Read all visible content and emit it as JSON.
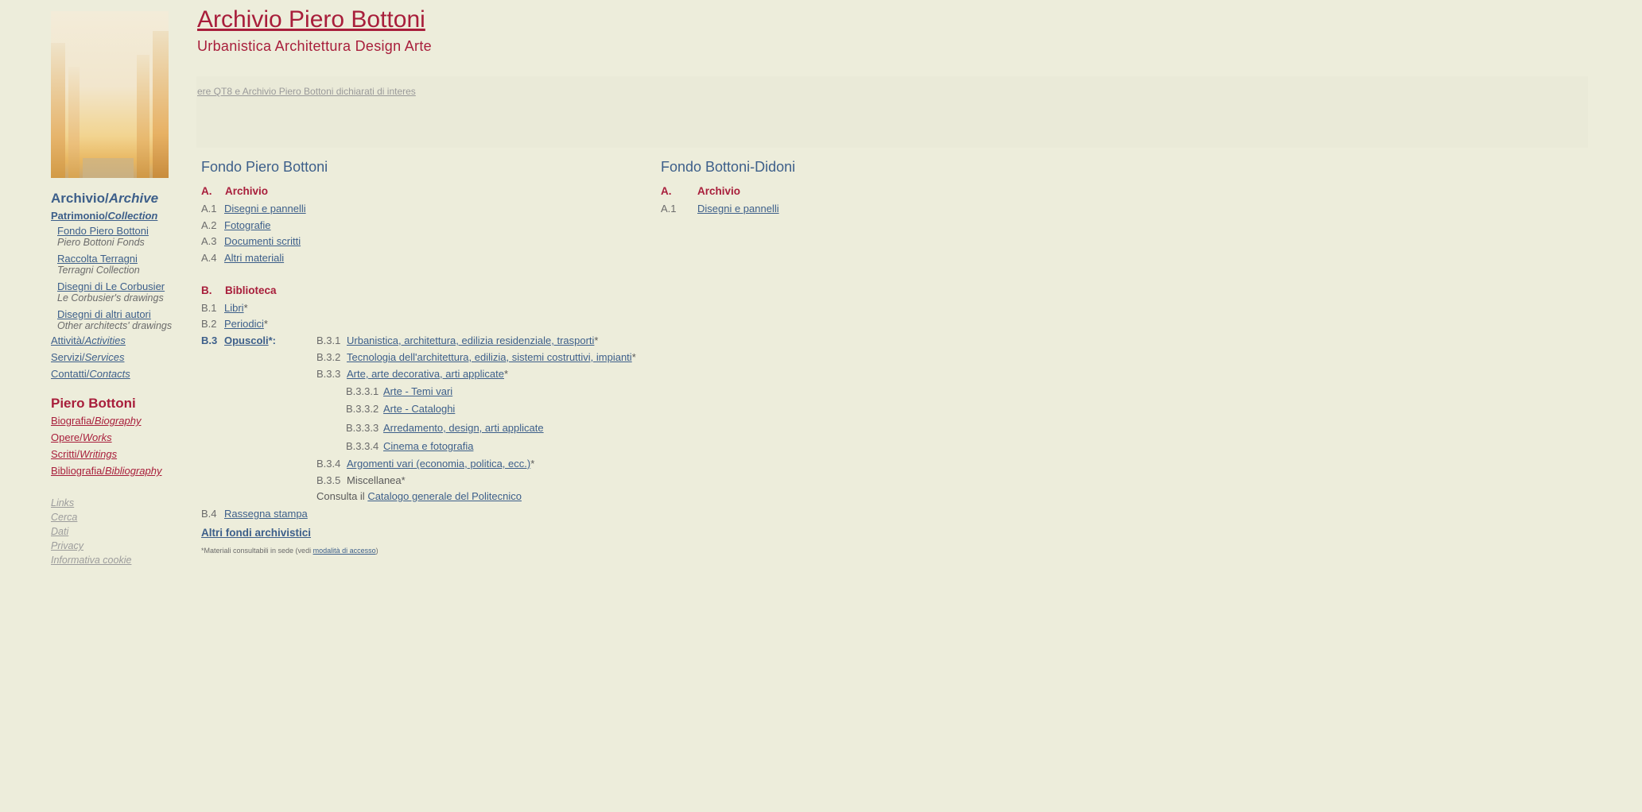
{
  "header": {
    "title": "Archivio Piero Bottoni",
    "subtitle": "Urbanistica  Architettura  Design  Arte",
    "marquee": "ere QT8 e Archivio Piero Bottoni dichiarati di interes"
  },
  "sidebar": {
    "archive_heading": "Archivio/",
    "archive_heading_en": "Archive",
    "collection": "Patrimonio/",
    "collection_en": "Collection",
    "funds": [
      {
        "label": "Fondo Piero Bottoni",
        "en": "Piero Bottoni Fonds"
      },
      {
        "label": "Raccolta Terragni",
        "en": "Terragni Collection"
      },
      {
        "label": "Disegni di Le Corbusier",
        "en": "Le Corbusier's drawings"
      },
      {
        "label": "Disegni di altri autori",
        "en": "Other architects' drawings"
      }
    ],
    "activities": "Attività/",
    "activities_en": "Activities",
    "services": "Servizi/",
    "services_en": "Services",
    "contacts": "Contatti/",
    "contacts_en": "Contacts",
    "bottoni_heading": "Piero Bottoni",
    "biography": "Biografia/",
    "biography_en": "Biography",
    "works": "Opere/",
    "works_en": "Works",
    "writings": "Scritti/",
    "writings_en": "Writings",
    "bibliography": "Bibliografia/",
    "bibliography_en": "Bibliography",
    "utility": [
      "Links",
      "Cerca",
      "Dati",
      "Privacy",
      "Informativa cookie"
    ]
  },
  "fondo_bottoni": {
    "title": "Fondo Piero Bottoni",
    "section_a": {
      "code": "A.",
      "label": "Archivio"
    },
    "a_items": [
      {
        "code": "A.1",
        "label": "Disegni e pannelli"
      },
      {
        "code": "A.2",
        "label": "Fotografie"
      },
      {
        "code": "A.3",
        "label": "Documenti scritti"
      },
      {
        "code": "A.4",
        "label": "Altri materiali"
      }
    ],
    "section_b": {
      "code": "B.",
      "label": "Biblioteca"
    },
    "b1": {
      "code": "B.1",
      "label": "Libri",
      "mark": "*"
    },
    "b2": {
      "code": "B.2",
      "label": "Periodici",
      "mark": "*"
    },
    "b3": {
      "code": "B.3",
      "label": "Opuscoli",
      "mark": "*:"
    },
    "b3_items": [
      {
        "code": "B.3.1",
        "label": "Urbanistica, architettura, edilizia residenziale, trasporti",
        "mark": "*"
      },
      {
        "code": "B.3.2",
        "label": "Tecnologia dell'architettura, edilizia, sistemi costruttivi, impianti",
        "mark": "*"
      },
      {
        "code": "B.3.3",
        "label": "Arte, arte decorativa, arti applicate",
        "mark": "*"
      }
    ],
    "b33_items": [
      {
        "code": "B.3.3.1",
        "label": "Arte - Temi vari"
      },
      {
        "code": "B.3.3.2",
        "label": "Arte - Cataloghi"
      },
      {
        "code": "B.3.3.3",
        "label": "Arredamento, design, arti applicate"
      },
      {
        "code": "B.3.3.4",
        "label": "Cinema e fotografia"
      }
    ],
    "b34": {
      "code": "B.3.4",
      "label": "Argomenti vari (economia, politica, ecc.)",
      "mark": "*"
    },
    "b35": {
      "code": "B.3.5",
      "label": "Miscellanea*"
    },
    "consulta": {
      "prefix": "Consulta il ",
      "label": "Catalogo generale del Politecnico"
    },
    "b4": {
      "code": "B.4",
      "label": "Rassegna stampa"
    },
    "altri_fondi": "Altri fondi archivistici",
    "footnote_prefix": "*Materiali consultabili in sede (vedi ",
    "footnote_link": "modalità di accesso",
    "footnote_suffix": ")"
  },
  "fondo_didoni": {
    "title": "Fondo Bottoni-Didoni",
    "section_a": {
      "code": "A.",
      "label": "Archivio"
    },
    "a1": {
      "code": "A.1",
      "label": "Disegni e pannelli"
    }
  },
  "colors": {
    "background": "#ededdb",
    "accent_red": "#a81e3b",
    "link_blue": "#3d5f8a"
  }
}
